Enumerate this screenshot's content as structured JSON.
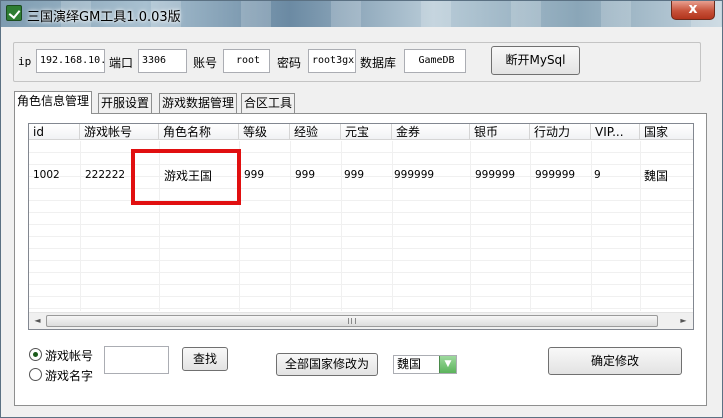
{
  "window": {
    "title": "三国演绎GM工具1.0.03版",
    "close_symbol": "x"
  },
  "connection": {
    "ip_label": "ip",
    "ip_value": "192.168.10.",
    "port_label": "端口",
    "port_value": "3306",
    "account_label": "账号",
    "account_value": "root",
    "password_label": "密码",
    "password_value": "root3gx",
    "database_label": "数据库",
    "database_value": "GameDB",
    "disconnect_button": "断开MySql"
  },
  "tabs": [
    {
      "label": "角色信息管理",
      "active": true
    },
    {
      "label": "开服设置",
      "active": false
    },
    {
      "label": "游戏数据管理",
      "active": false
    },
    {
      "label": "合区工具",
      "active": false
    }
  ],
  "grid": {
    "columns": [
      "id",
      "游戏帐号",
      "角色名称",
      "等级",
      "经验",
      "元宝",
      "金券",
      "银币",
      "行动力",
      "VIP...",
      "国家"
    ],
    "rows": [
      [
        "1002",
        "222222",
        "游戏王国",
        "999",
        "999",
        "999",
        "999999",
        "999999",
        "999999",
        "9",
        "魏国"
      ]
    ],
    "scroll_left": "◄",
    "scroll_right": "►",
    "highlight_color": "#e10f10"
  },
  "search": {
    "radio_account": "游戏帐号",
    "radio_name": "游戏名字",
    "selected": "account",
    "input_value": "",
    "search_button": "查找"
  },
  "nation": {
    "change_all_button": "全部国家修改为",
    "selected": "魏国",
    "dropdown_symbol": "▼"
  },
  "confirm_button": "确定修改"
}
